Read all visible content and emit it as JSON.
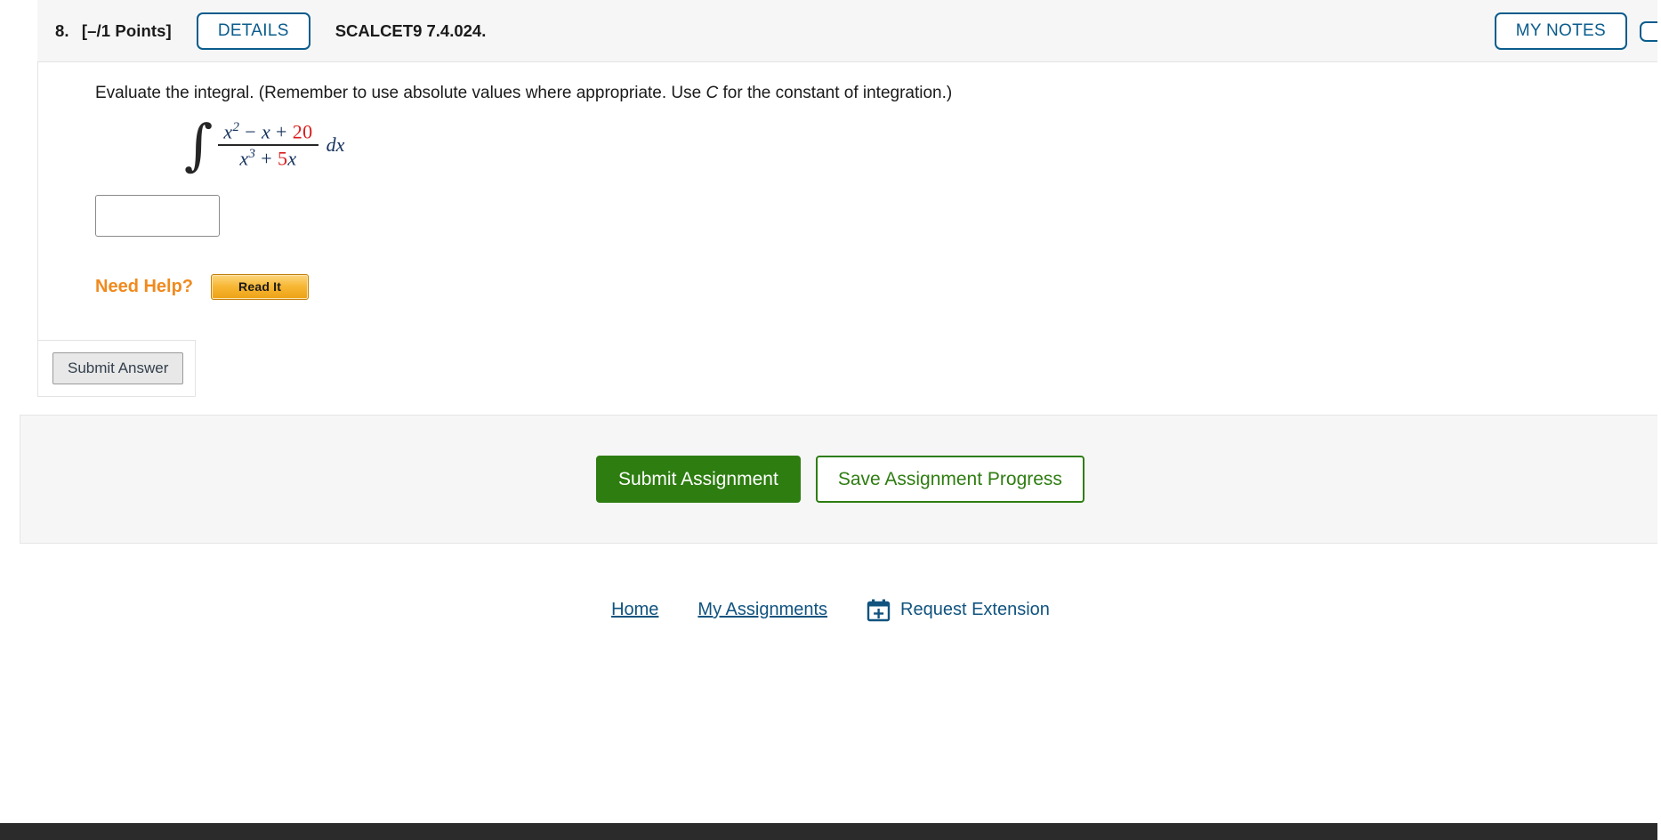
{
  "question": {
    "number": "8.",
    "points": "[–/1 Points]",
    "details_label": "DETAILS",
    "code": "SCALCET9 7.4.024.",
    "my_notes_label": "MY NOTES",
    "prompt_part1": "Evaluate the integral. (Remember to use absolute values where appropriate. Use ",
    "prompt_variable": "C",
    "prompt_part2": " for the constant of integration.)",
    "integral": {
      "integral_sign": "∫",
      "numerator_x": "x",
      "numerator_exp": "2",
      "numerator_minus": " − ",
      "numerator_x2": "x",
      "numerator_plus": " + ",
      "numerator_constant": "20",
      "denominator_x": "x",
      "denominator_exp": "3",
      "denominator_plus": " + ",
      "denominator_coefficient": "5",
      "denominator_x2": "x",
      "differential": "dx",
      "highlight_color": "#d91b1b",
      "expression_color": "#13315c",
      "latex": "\\int \\frac{x^2 - x + 20}{x^3 + 5x}\\,dx"
    },
    "answer_value": "",
    "answer_placeholder": "",
    "need_help_label": "Need Help?",
    "read_it_label": "Read It",
    "submit_answer_label": "Submit Answer"
  },
  "assignment_actions": {
    "submit_label": "Submit Assignment",
    "save_label": "Save Assignment Progress",
    "accent_green": "#2e7d11"
  },
  "footer": {
    "home_label": "Home",
    "my_assignments_label": "My Assignments",
    "request_extension_label": "Request Extension",
    "link_color": "#10537f",
    "calendar_icon": "calendar-plus-icon"
  }
}
